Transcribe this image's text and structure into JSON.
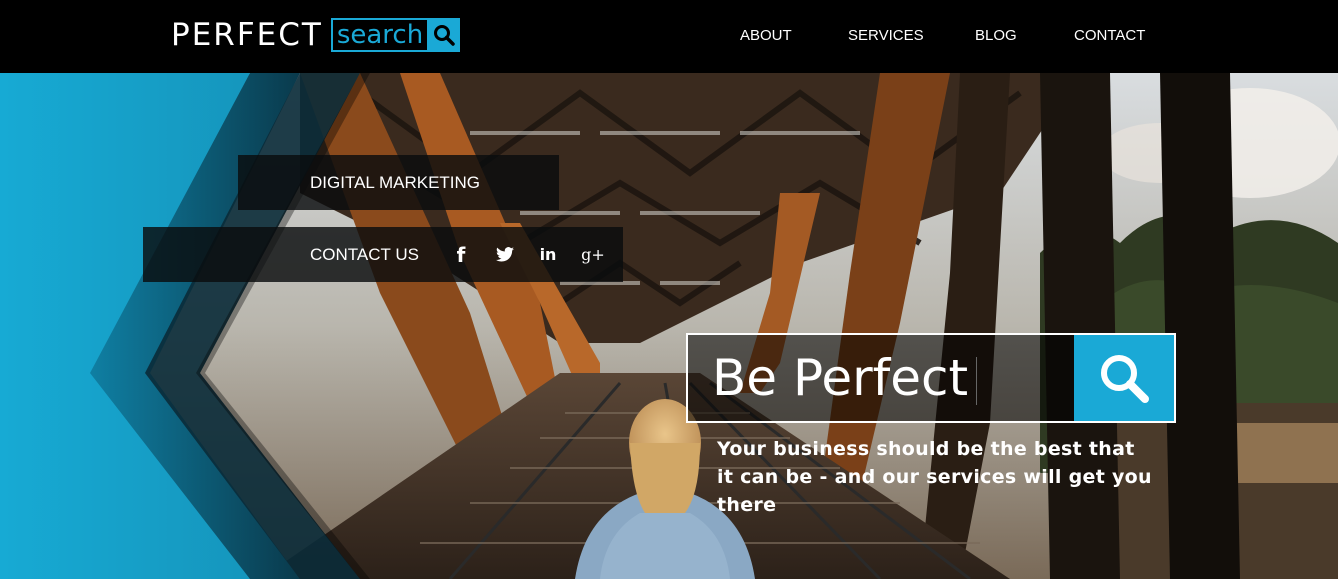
{
  "header": {
    "logo_primary": "PERFECT",
    "logo_secondary": "search",
    "nav": [
      {
        "label": "ABOUT"
      },
      {
        "label": "SERVICES"
      },
      {
        "label": "BLOG"
      },
      {
        "label": "CONTACT"
      }
    ]
  },
  "hero": {
    "tabs": {
      "digital_marketing": "DIGITAL MARKETING",
      "contact_us": "CONTACT US"
    },
    "social": {
      "facebook": "f",
      "linkedin": "in",
      "googleplus": "g+"
    },
    "search": {
      "value": "Be Perfect"
    },
    "tagline": "Your business should be the best that it can be - and our services will get you there"
  },
  "colors": {
    "accent": "#1aa9d6",
    "header_bg": "#000000",
    "tab_bg": "#0a0c0e"
  },
  "icons": [
    "search-icon",
    "facebook-icon",
    "twitter-icon",
    "linkedin-icon",
    "google-plus-icon"
  ]
}
